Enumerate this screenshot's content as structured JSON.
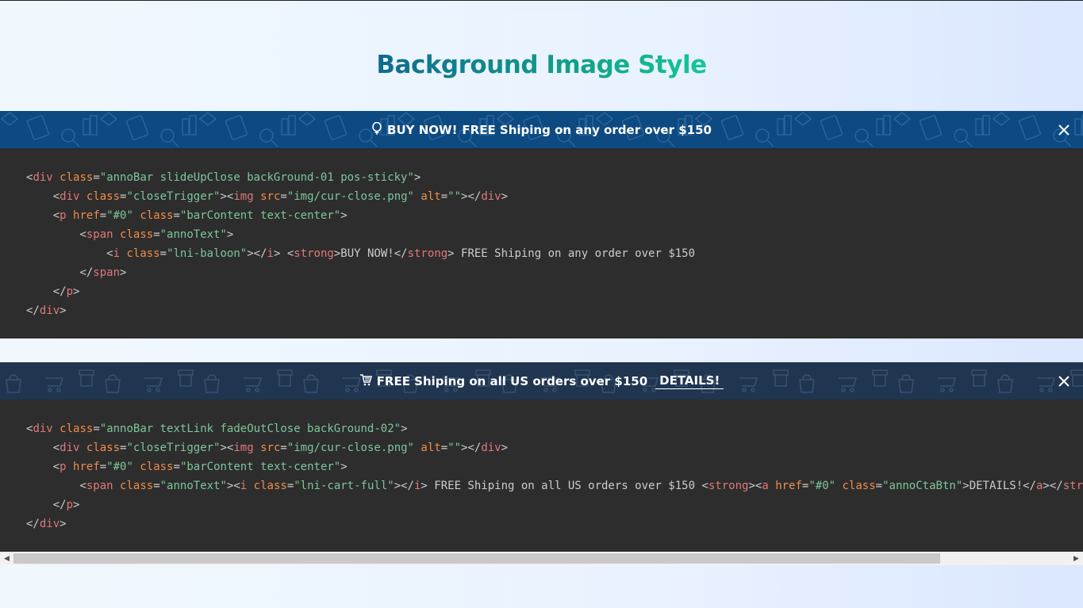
{
  "page": {
    "title": "Background Image Style"
  },
  "bar1": {
    "icon": "balloon-icon",
    "strong": "BUY NOW!",
    "text": "FREE Shiping on any order over $150",
    "close_icon": "close-icon"
  },
  "code1": {
    "lines": [
      [
        "<div class=\"annoBar slideUpClose backGround-01 pos-sticky\">"
      ],
      [
        "    <div class=\"closeTrigger\"><img src=\"img/cur-close.png\" alt=\"\"></div>"
      ],
      [
        "    <p href=\"#0\" class=\"barContent text-center\">"
      ],
      [
        "        <span class=\"annoText\">"
      ],
      [
        "            <i class=\"lni-baloon\"></i> <strong>BUY NOW!</strong> FREE Shiping on any order over $150"
      ],
      [
        "        </span>"
      ],
      [
        "    </p>"
      ],
      [
        "</div>"
      ]
    ]
  },
  "bar2": {
    "icon": "cart-full-icon",
    "text": "FREE Shiping on all US orders over $150",
    "cta": "DETAILS!",
    "close_icon": "close-icon"
  },
  "code2": {
    "lines": [
      [
        "<div class=\"annoBar textLink fadeOutClose backGround-02\">"
      ],
      [
        "    <div class=\"closeTrigger\"><img src=\"img/cur-close.png\" alt=\"\"></div>"
      ],
      [
        "    <p href=\"#0\" class=\"barContent text-center\">"
      ],
      [
        "        <span class=\"annoText\"><i class=\"lni-cart-full\"></i> FREE Shiping on all US orders over $150 <strong><a href=\"#0\" class=\"annoCtaBtn\">DETAILS!</a></strong></span>"
      ],
      [
        "    </p>"
      ],
      [
        "</div>"
      ]
    ]
  },
  "scrollbar": {
    "left_icon": "scroll-left-arrow-icon",
    "right_icon": "scroll-right-arrow-icon",
    "position": 0
  }
}
